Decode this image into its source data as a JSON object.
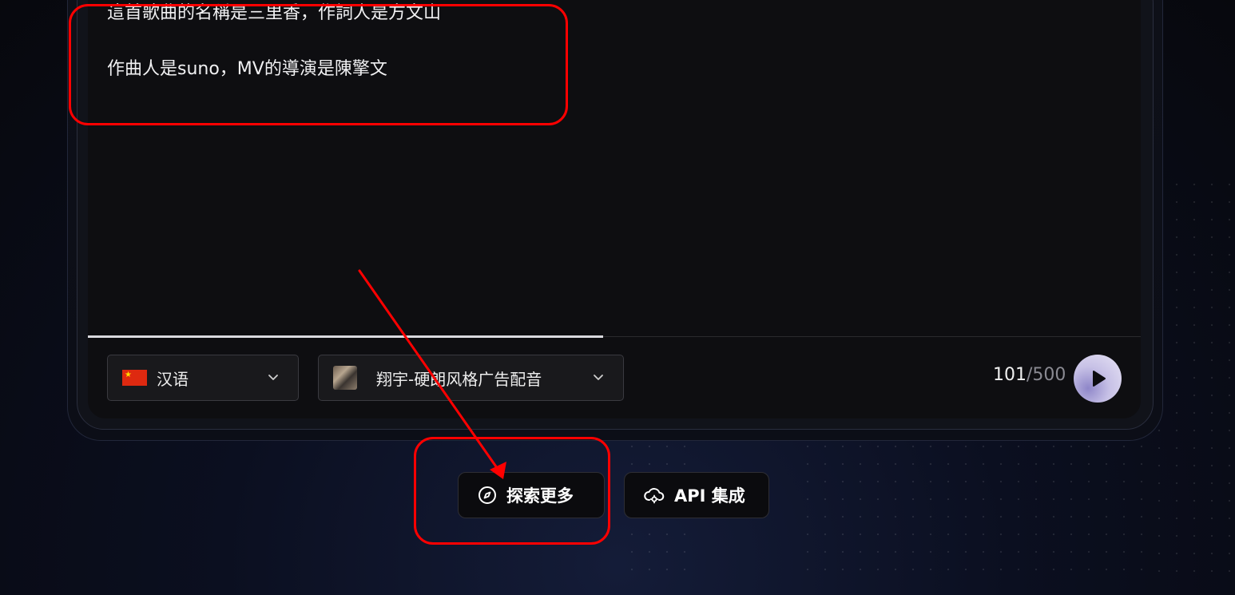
{
  "text_area": {
    "line1": "這首歌曲的名稱是三里香，作詞人是方文山",
    "line2": "作曲人是suno，MV的導演是陳擎文"
  },
  "language_select": {
    "value": "汉语",
    "icon": "china-flag-icon"
  },
  "voice_select": {
    "value": "翔宇-硬朗风格广告配音",
    "icon": "voice-avatar"
  },
  "char_counter": {
    "current": "101",
    "separator": "/",
    "max": "500"
  },
  "progress": {
    "fraction": 0.49
  },
  "buttons": {
    "explore_label": "探索更多",
    "api_label": "API 集成"
  },
  "colors": {
    "annotation": "#ff0000",
    "panel_bg": "#0e0e11",
    "page_bg": "#0b0f20"
  }
}
